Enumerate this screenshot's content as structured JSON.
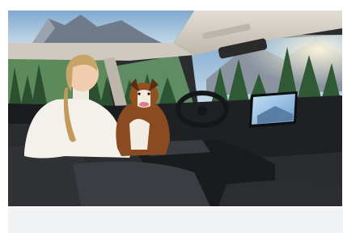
{
  "photo": {
    "subject": "woman-with-dog-in-car-interior"
  },
  "colors": {
    "sky": "#8fb7d6",
    "mountains": "#6f7b8a",
    "forest": "#2f5a35",
    "roof_trim": "#d9d4cc",
    "interior_dark": "#1f2124",
    "screen": "#9fc4e8",
    "sweater": "#f4f1ea",
    "dog_brown": "#8a4a22",
    "card_footer": "#f1f2f4"
  }
}
